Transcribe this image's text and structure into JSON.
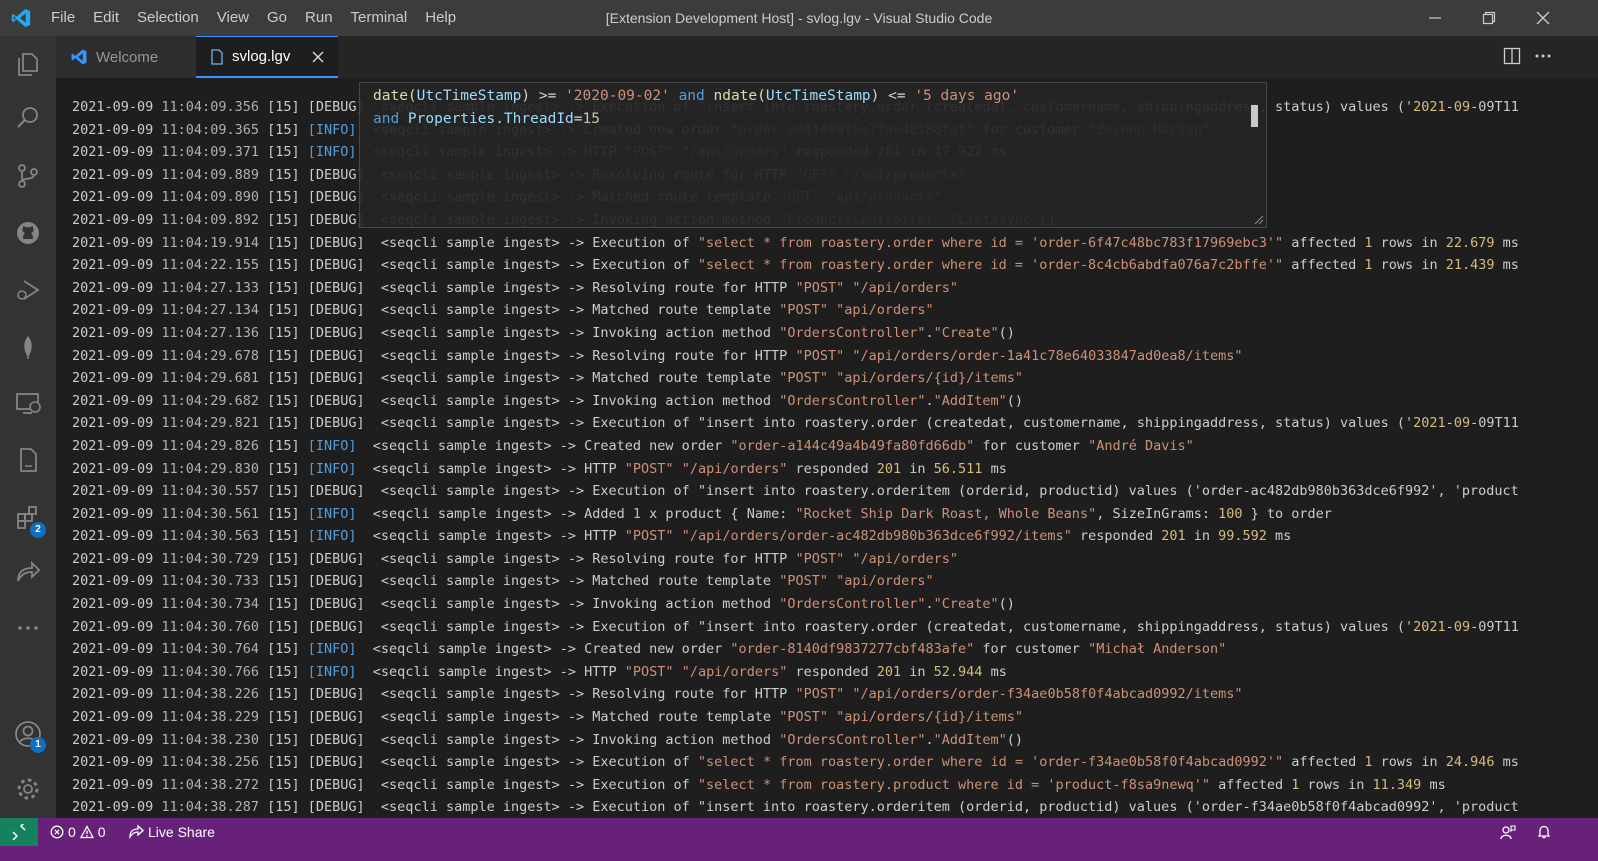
{
  "titlebar": {
    "menus": [
      "File",
      "Edit",
      "Selection",
      "View",
      "Go",
      "Run",
      "Terminal",
      "Help"
    ],
    "title": "[Extension Development Host] - svlog.lgv - Visual Studio Code"
  },
  "activity": {
    "extensions_badge": "2",
    "accounts_badge": "1"
  },
  "tabs": [
    {
      "label": "Welcome"
    },
    {
      "label": "svlog.lgv"
    }
  ],
  "filter": {
    "line1": [
      "date(",
      "UtcTimeStamp",
      ") >= ",
      "'2020-09-02'",
      " and ",
      "ndate(",
      "UtcTimeStamp",
      ") <= ",
      "'5 days ago'"
    ],
    "line2": [
      "and ",
      "Properties.ThreadId",
      "=",
      "15"
    ]
  },
  "log": [
    {
      "date": "2021-09-09",
      "time": "11:04:09.356",
      "thread": "[15]",
      "level": "[DEBUG]",
      "msg": "  <seqcli sample ingest> -> Execution of \"insert into roastery.order (createdat, customername, shippingaddress, status) values ('2021-09-09T11"
    },
    {
      "date": "2021-09-09",
      "time": "11:04:09.365",
      "thread": "[15]",
      "level": "[INFO]",
      "msg": "  <seqcli sample ingest> -> Created new order \"order-ad41499f5e7fae48188faf\" for customer \"Zeynep Martin\""
    },
    {
      "date": "2021-09-09",
      "time": "11:04:09.371",
      "thread": "[15]",
      "level": "[INFO]",
      "msg": "  <seqcli sample ingest> -> HTTP \"POST\" \"/api/orders\" responded 201 in 47.922 ms"
    },
    {
      "date": "2021-09-09",
      "time": "11:04:09.889",
      "thread": "[15]",
      "level": "[DEBUG]",
      "msg": "  <seqcli sample ingest> -> Resolving route for HTTP \"GET\" \"/api/products\""
    },
    {
      "date": "2021-09-09",
      "time": "11:04:09.890",
      "thread": "[15]",
      "level": "[DEBUG]",
      "msg": "  <seqcli sample ingest> -> Matched route template \"GET\" \"api/products\""
    },
    {
      "date": "2021-09-09",
      "time": "11:04:09.892",
      "thread": "[15]",
      "level": "[DEBUG]",
      "msg": "  <seqcli sample ingest> -> Invoking action method \"ProductsController\".\"ListAsync\"()"
    },
    {
      "date": "2021-09-09",
      "time": "11:04:19.914",
      "thread": "[15]",
      "level": "[DEBUG]",
      "msg": "  <seqcli sample ingest> -> Execution of \"select * from roastery.order where id = 'order-6f47c48bc783f17969ebc3'\" affected 1 rows in 22.679 ms"
    },
    {
      "date": "2021-09-09",
      "time": "11:04:22.155",
      "thread": "[15]",
      "level": "[DEBUG]",
      "msg": "  <seqcli sample ingest> -> Execution of \"select * from roastery.order where id = 'order-8c4cb6abdfa076a7c2bffe'\" affected 1 rows in 21.439 ms"
    },
    {
      "date": "2021-09-09",
      "time": "11:04:27.133",
      "thread": "[15]",
      "level": "[DEBUG]",
      "msg": "  <seqcli sample ingest> -> Resolving route for HTTP \"POST\" \"/api/orders\""
    },
    {
      "date": "2021-09-09",
      "time": "11:04:27.134",
      "thread": "[15]",
      "level": "[DEBUG]",
      "msg": "  <seqcli sample ingest> -> Matched route template \"POST\" \"api/orders\""
    },
    {
      "date": "2021-09-09",
      "time": "11:04:27.136",
      "thread": "[15]",
      "level": "[DEBUG]",
      "msg": "  <seqcli sample ingest> -> Invoking action method \"OrdersController\".\"Create\"()"
    },
    {
      "date": "2021-09-09",
      "time": "11:04:29.678",
      "thread": "[15]",
      "level": "[DEBUG]",
      "msg": "  <seqcli sample ingest> -> Resolving route for HTTP \"POST\" \"/api/orders/order-1a41c78e64033847ad0ea8/items\""
    },
    {
      "date": "2021-09-09",
      "time": "11:04:29.681",
      "thread": "[15]",
      "level": "[DEBUG]",
      "msg": "  <seqcli sample ingest> -> Matched route template \"POST\" \"api/orders/{id}/items\""
    },
    {
      "date": "2021-09-09",
      "time": "11:04:29.682",
      "thread": "[15]",
      "level": "[DEBUG]",
      "msg": "  <seqcli sample ingest> -> Invoking action method \"OrdersController\".\"AddItem\"()"
    },
    {
      "date": "2021-09-09",
      "time": "11:04:29.821",
      "thread": "[15]",
      "level": "[DEBUG]",
      "msg": "  <seqcli sample ingest> -> Execution of \"insert into roastery.order (createdat, customername, shippingaddress, status) values ('2021-09-09T11"
    },
    {
      "date": "2021-09-09",
      "time": "11:04:29.826",
      "thread": "[15]",
      "level": "[INFO]",
      "msg": "  <seqcli sample ingest> -> Created new order \"order-a144c49a4b49fa80fd66db\" for customer \"André Davis\""
    },
    {
      "date": "2021-09-09",
      "time": "11:04:29.830",
      "thread": "[15]",
      "level": "[INFO]",
      "msg": "  <seqcli sample ingest> -> HTTP \"POST\" \"/api/orders\" responded 201 in 56.511 ms"
    },
    {
      "date": "2021-09-09",
      "time": "11:04:30.557",
      "thread": "[15]",
      "level": "[DEBUG]",
      "msg": "  <seqcli sample ingest> -> Execution of \"insert into roastery.orderitem (orderid, productid) values ('order-ac482db980b363dce6f992', 'product"
    },
    {
      "date": "2021-09-09",
      "time": "11:04:30.561",
      "thread": "[15]",
      "level": "[INFO]",
      "msg": "  <seqcli sample ingest> -> Added 1 x product { Name: \"Rocket Ship Dark Roast, Whole Beans\", SizeInGrams: 100 } to order"
    },
    {
      "date": "2021-09-09",
      "time": "11:04:30.563",
      "thread": "[15]",
      "level": "[INFO]",
      "msg": "  <seqcli sample ingest> -> HTTP \"POST\" \"/api/orders/order-ac482db980b363dce6f992/items\" responded 201 in 99.592 ms"
    },
    {
      "date": "2021-09-09",
      "time": "11:04:30.729",
      "thread": "[15]",
      "level": "[DEBUG]",
      "msg": "  <seqcli sample ingest> -> Resolving route for HTTP \"POST\" \"/api/orders\""
    },
    {
      "date": "2021-09-09",
      "time": "11:04:30.733",
      "thread": "[15]",
      "level": "[DEBUG]",
      "msg": "  <seqcli sample ingest> -> Matched route template \"POST\" \"api/orders\""
    },
    {
      "date": "2021-09-09",
      "time": "11:04:30.734",
      "thread": "[15]",
      "level": "[DEBUG]",
      "msg": "  <seqcli sample ingest> -> Invoking action method \"OrdersController\".\"Create\"()"
    },
    {
      "date": "2021-09-09",
      "time": "11:04:30.760",
      "thread": "[15]",
      "level": "[DEBUG]",
      "msg": "  <seqcli sample ingest> -> Execution of \"insert into roastery.order (createdat, customername, shippingaddress, status) values ('2021-09-09T11"
    },
    {
      "date": "2021-09-09",
      "time": "11:04:30.764",
      "thread": "[15]",
      "level": "[INFO]",
      "msg": "  <seqcli sample ingest> -> Created new order \"order-8140df9837277cbf483afe\" for customer \"Michał Anderson\""
    },
    {
      "date": "2021-09-09",
      "time": "11:04:30.766",
      "thread": "[15]",
      "level": "[INFO]",
      "msg": "  <seqcli sample ingest> -> HTTP \"POST\" \"/api/orders\" responded 201 in 52.944 ms"
    },
    {
      "date": "2021-09-09",
      "time": "11:04:38.226",
      "thread": "[15]",
      "level": "[DEBUG]",
      "msg": "  <seqcli sample ingest> -> Resolving route for HTTP \"POST\" \"/api/orders/order-f34ae0b58f0f4abcad0992/items\""
    },
    {
      "date": "2021-09-09",
      "time": "11:04:38.229",
      "thread": "[15]",
      "level": "[DEBUG]",
      "msg": "  <seqcli sample ingest> -> Matched route template \"POST\" \"api/orders/{id}/items\""
    },
    {
      "date": "2021-09-09",
      "time": "11:04:38.230",
      "thread": "[15]",
      "level": "[DEBUG]",
      "msg": "  <seqcli sample ingest> -> Invoking action method \"OrdersController\".\"AddItem\"()"
    },
    {
      "date": "2021-09-09",
      "time": "11:04:38.256",
      "thread": "[15]",
      "level": "[DEBUG]",
      "msg": "  <seqcli sample ingest> -> Execution of \"select * from roastery.order where id = 'order-f34ae0b58f0f4abcad0992'\" affected 1 rows in 24.946 ms"
    },
    {
      "date": "2021-09-09",
      "time": "11:04:38.272",
      "thread": "[15]",
      "level": "[DEBUG]",
      "msg": "  <seqcli sample ingest> -> Execution of \"select * from roastery.product where id = 'product-f8sa9newq'\" affected 1 rows in 11.349 ms"
    },
    {
      "date": "2021-09-09",
      "time": "11:04:38.287",
      "thread": "[15]",
      "level": "[DEBUG]",
      "msg": "  <seqcli sample ingest> -> Execution of \"insert into roastery.orderitem (orderid, productid) values ('order-f34ae0b58f0f4abcad0992', 'product"
    }
  ],
  "status": {
    "errors": "0",
    "warnings": "0",
    "live_share": "Live Share"
  },
  "colors": {
    "status_bar": "#68217a",
    "remote": "#16825d",
    "accent": "#3794ff",
    "info_level": "#569cd6",
    "string": "#ce9178",
    "number": "#d7ba7d"
  }
}
